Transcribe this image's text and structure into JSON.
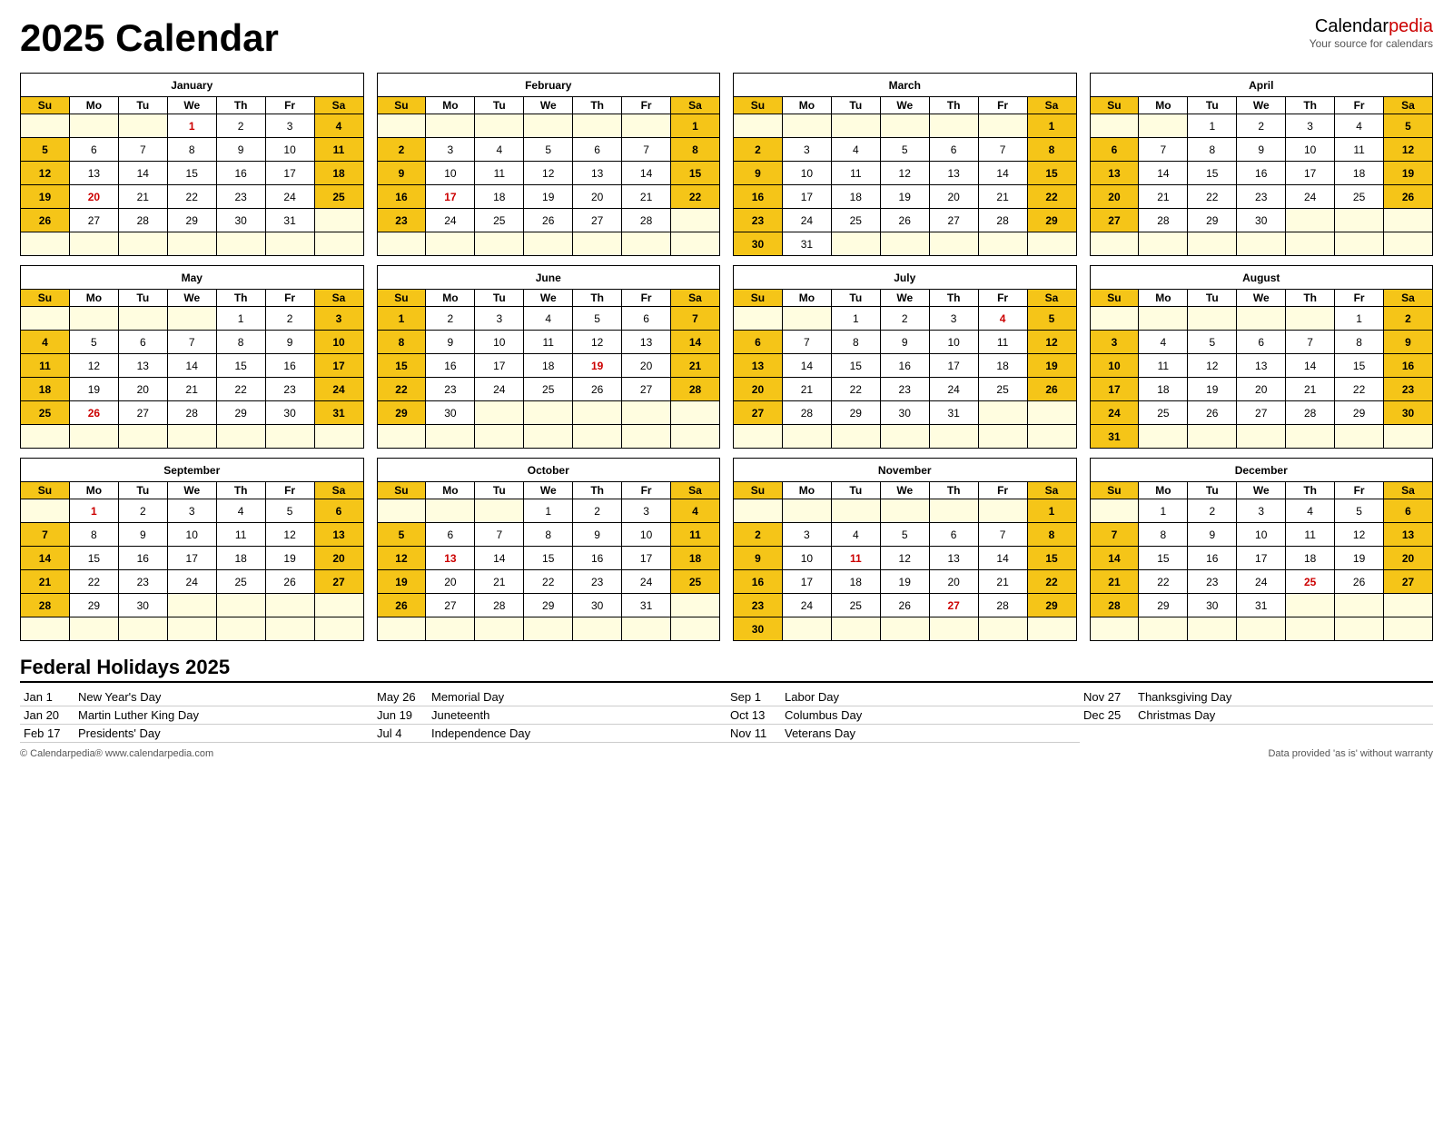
{
  "header": {
    "title": "2025 Calendar",
    "brand_name": "Calendar",
    "brand_pedia": "pedia",
    "brand_sub": "Your source for calendars"
  },
  "months": [
    {
      "name": "January",
      "weeks": [
        [
          "",
          "",
          "",
          "1*",
          "2",
          "3",
          "4"
        ],
        [
          "5",
          "6",
          "7",
          "8",
          "9",
          "10",
          "11"
        ],
        [
          "12",
          "13",
          "14",
          "15",
          "16",
          "17",
          "18"
        ],
        [
          "19",
          "20*",
          "21",
          "22",
          "23",
          "24",
          "25"
        ],
        [
          "26",
          "27",
          "28",
          "29",
          "30",
          "31",
          ""
        ],
        [
          "",
          "",
          "",
          "",
          "",
          "",
          ""
        ]
      ]
    },
    {
      "name": "February",
      "weeks": [
        [
          "",
          "",
          "",
          "",
          "",
          "",
          "1"
        ],
        [
          "2",
          "3",
          "4",
          "5",
          "6",
          "7",
          "8"
        ],
        [
          "9",
          "10",
          "11",
          "12",
          "13",
          "14",
          "15"
        ],
        [
          "16",
          "17*",
          "18",
          "19",
          "20",
          "21",
          "22"
        ],
        [
          "23",
          "24",
          "25",
          "26",
          "27",
          "28",
          ""
        ],
        [
          "",
          "",
          "",
          "",
          "",
          "",
          ""
        ]
      ]
    },
    {
      "name": "March",
      "weeks": [
        [
          "",
          "",
          "",
          "",
          "",
          "",
          "1"
        ],
        [
          "2",
          "3",
          "4",
          "5",
          "6",
          "7",
          "8"
        ],
        [
          "9",
          "10",
          "11",
          "12",
          "13",
          "14",
          "15"
        ],
        [
          "16",
          "17",
          "18",
          "19",
          "20",
          "21",
          "22"
        ],
        [
          "23",
          "24",
          "25",
          "26",
          "27",
          "28",
          "29"
        ],
        [
          "30",
          "31",
          "",
          "",
          "",
          "",
          ""
        ]
      ]
    },
    {
      "name": "April",
      "weeks": [
        [
          "",
          "",
          "1",
          "2",
          "3",
          "4",
          "5"
        ],
        [
          "6",
          "7",
          "8",
          "9",
          "10",
          "11",
          "12"
        ],
        [
          "13",
          "14",
          "15",
          "16",
          "17",
          "18",
          "19"
        ],
        [
          "20",
          "21",
          "22",
          "23",
          "24",
          "25",
          "26"
        ],
        [
          "27",
          "28",
          "29",
          "30",
          "",
          "",
          ""
        ],
        [
          "",
          "",
          "",
          "",
          "",
          "",
          ""
        ]
      ]
    },
    {
      "name": "May",
      "weeks": [
        [
          "",
          "",
          "",
          "",
          "1",
          "2",
          "3"
        ],
        [
          "4",
          "5",
          "6",
          "7",
          "8",
          "9",
          "10"
        ],
        [
          "11",
          "12",
          "13",
          "14",
          "15",
          "16",
          "17"
        ],
        [
          "18",
          "19",
          "20",
          "21",
          "22",
          "23",
          "24"
        ],
        [
          "25",
          "26*",
          "27",
          "28",
          "29",
          "30",
          "31"
        ],
        [
          "",
          "",
          "",
          "",
          "",
          "",
          ""
        ]
      ]
    },
    {
      "name": "June",
      "weeks": [
        [
          "1",
          "2",
          "3",
          "4",
          "5",
          "6",
          "7"
        ],
        [
          "8",
          "9",
          "10",
          "11",
          "12",
          "13",
          "14"
        ],
        [
          "15",
          "16",
          "17",
          "18",
          "19*",
          "20",
          "21"
        ],
        [
          "22",
          "23",
          "24",
          "25",
          "26",
          "27",
          "28"
        ],
        [
          "29",
          "30",
          "",
          "",
          "",
          "",
          ""
        ],
        [
          "",
          "",
          "",
          "",
          "",
          "",
          ""
        ]
      ]
    },
    {
      "name": "July",
      "weeks": [
        [
          "",
          "",
          "1",
          "2",
          "3",
          "4*",
          "5"
        ],
        [
          "6",
          "7",
          "8",
          "9",
          "10",
          "11",
          "12"
        ],
        [
          "13",
          "14",
          "15",
          "16",
          "17",
          "18",
          "19"
        ],
        [
          "20",
          "21",
          "22",
          "23",
          "24",
          "25",
          "26"
        ],
        [
          "27",
          "28",
          "29",
          "30",
          "31",
          "",
          ""
        ],
        [
          "",
          "",
          "",
          "",
          "",
          "",
          ""
        ]
      ]
    },
    {
      "name": "August",
      "weeks": [
        [
          "",
          "",
          "",
          "",
          "",
          "1",
          "2"
        ],
        [
          "3",
          "4",
          "5",
          "6",
          "7",
          "8",
          "9"
        ],
        [
          "10",
          "11",
          "12",
          "13",
          "14",
          "15",
          "16"
        ],
        [
          "17",
          "18",
          "19",
          "20",
          "21",
          "22",
          "23"
        ],
        [
          "24",
          "25",
          "26",
          "27",
          "28",
          "29",
          "30"
        ],
        [
          "31",
          "",
          "",
          "",
          "",
          "",
          ""
        ]
      ]
    },
    {
      "name": "September",
      "weeks": [
        [
          "",
          "1*",
          "2",
          "3",
          "4",
          "5",
          "6"
        ],
        [
          "7",
          "8",
          "9",
          "10",
          "11",
          "12",
          "13"
        ],
        [
          "14",
          "15",
          "16",
          "17",
          "18",
          "19",
          "20"
        ],
        [
          "21",
          "22",
          "23",
          "24",
          "25",
          "26",
          "27"
        ],
        [
          "28",
          "29",
          "30",
          "",
          "",
          "",
          ""
        ],
        [
          "",
          "",
          "",
          "",
          "",
          "",
          ""
        ]
      ]
    },
    {
      "name": "October",
      "weeks": [
        [
          "",
          "",
          "",
          "1",
          "2",
          "3",
          "4"
        ],
        [
          "5",
          "6",
          "7",
          "8",
          "9",
          "10",
          "11"
        ],
        [
          "12",
          "13*",
          "14",
          "15",
          "16",
          "17",
          "18"
        ],
        [
          "19",
          "20",
          "21",
          "22",
          "23",
          "24",
          "25"
        ],
        [
          "26",
          "27",
          "28",
          "29",
          "30",
          "31",
          ""
        ],
        [
          "",
          "",
          "",
          "",
          "",
          "",
          ""
        ]
      ]
    },
    {
      "name": "November",
      "weeks": [
        [
          "",
          "",
          "",
          "",
          "",
          "",
          "1"
        ],
        [
          "2",
          "3",
          "4",
          "5",
          "6",
          "7",
          "8"
        ],
        [
          "9",
          "10",
          "11*",
          "12",
          "13",
          "14",
          "15"
        ],
        [
          "16",
          "17",
          "18",
          "19",
          "20",
          "21",
          "22"
        ],
        [
          "23",
          "24",
          "25",
          "26",
          "27*",
          "28",
          "29"
        ],
        [
          "30",
          "",
          "",
          "",
          "",
          "",
          ""
        ]
      ]
    },
    {
      "name": "December",
      "weeks": [
        [
          "",
          "1",
          "2",
          "3",
          "4",
          "5",
          "6"
        ],
        [
          "7",
          "8",
          "9",
          "10",
          "11",
          "12",
          "13"
        ],
        [
          "14",
          "15",
          "16",
          "17",
          "18",
          "19",
          "20"
        ],
        [
          "21",
          "22",
          "23",
          "24",
          "25*",
          "26",
          "27"
        ],
        [
          "28",
          "29",
          "30",
          "31",
          "",
          "",
          ""
        ],
        [
          "",
          "",
          "",
          "",
          "",
          "",
          ""
        ]
      ]
    }
  ],
  "day_headers": [
    "Su",
    "Mo",
    "Tu",
    "We",
    "Th",
    "Fr",
    "Sa"
  ],
  "holidays": {
    "title": "Federal Holidays 2025",
    "columns": [
      [
        {
          "date": "Jan 1",
          "name": "New Year's Day"
        },
        {
          "date": "Jan 20",
          "name": "Martin Luther King Day"
        },
        {
          "date": "Feb 17",
          "name": "Presidents' Day"
        }
      ],
      [
        {
          "date": "May 26",
          "name": "Memorial Day"
        },
        {
          "date": "Jun 19",
          "name": "Juneteenth"
        },
        {
          "date": "Jul 4",
          "name": "Independence Day"
        }
      ],
      [
        {
          "date": "Sep 1",
          "name": "Labor Day"
        },
        {
          "date": "Oct 13",
          "name": "Columbus Day"
        },
        {
          "date": "Nov 11",
          "name": "Veterans Day"
        }
      ],
      [
        {
          "date": "Nov 27",
          "name": "Thanksgiving Day"
        },
        {
          "date": "Dec 25",
          "name": "Christmas Day"
        },
        {
          "date": "",
          "name": ""
        }
      ]
    ]
  },
  "footer": {
    "copyright": "© Calendarpedia®  www.calendarpedia.com",
    "disclaimer": "Data provided 'as is' without warranty"
  }
}
